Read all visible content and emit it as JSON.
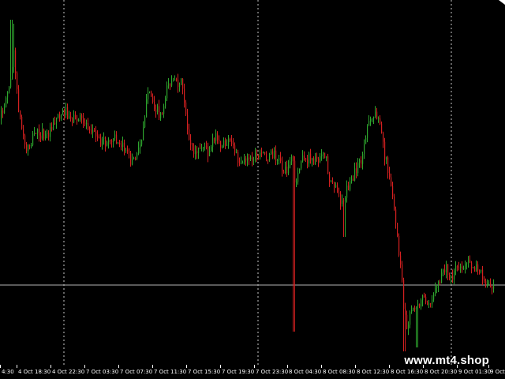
{
  "chart_data": {
    "type": "candlestick",
    "colors": {
      "background": "#000000",
      "bull": "#2ea62e",
      "bear": "#d42020",
      "grid": "#c8c8c8",
      "price_line": "#b4b4b4",
      "text": "#ffffff"
    },
    "grid": "vertical dotted at day separators",
    "x_ticks": [
      "4:30",
      "4 Oct 18:30",
      "4 Oct 22:30",
      "7 Oct 03:30",
      "7 Oct 07:30",
      "7 Oct 11:30",
      "7 Oct 15:30",
      "7 Oct 19:30",
      "7 Oct 23:30",
      "8 Oct 04:30",
      "8 Oct 08:30",
      "8 Oct 12:30",
      "8 Oct 16:30",
      "8 Oct 20:30",
      "9 Oct 01:30",
      "9 Oct 0"
    ],
    "series": [
      {
        "anchors": [
          [
            0,
            150
          ],
          [
            8,
            120
          ],
          [
            14,
            100
          ],
          [
            17,
            60
          ],
          [
            20,
            110
          ],
          [
            25,
            150
          ],
          [
            32,
            190
          ],
          [
            38,
            180
          ],
          [
            45,
            165
          ],
          [
            52,
            170
          ],
          [
            58,
            175
          ],
          [
            66,
            155
          ],
          [
            74,
            145
          ],
          [
            82,
            140
          ],
          [
            90,
            150
          ],
          [
            98,
            150
          ],
          [
            106,
            155
          ],
          [
            114,
            160
          ],
          [
            122,
            175
          ],
          [
            130,
            180
          ],
          [
            138,
            180
          ],
          [
            146,
            175
          ],
          [
            154,
            180
          ],
          [
            160,
            195
          ],
          [
            166,
            205
          ],
          [
            172,
            200
          ],
          [
            178,
            180
          ],
          [
            182,
            150
          ],
          [
            186,
            125
          ],
          [
            190,
            120
          ],
          [
            196,
            135
          ],
          [
            202,
            145
          ],
          [
            206,
            140
          ],
          [
            210,
            110
          ],
          [
            216,
            105
          ],
          [
            222,
            108
          ],
          [
            228,
            100
          ],
          [
            232,
            115
          ],
          [
            236,
            155
          ],
          [
            240,
            180
          ],
          [
            246,
            195
          ],
          [
            252,
            190
          ],
          [
            258,
            185
          ],
          [
            264,
            195
          ],
          [
            270,
            170
          ],
          [
            276,
            180
          ],
          [
            282,
            185
          ],
          [
            288,
            180
          ],
          [
            294,
            185
          ],
          [
            298,
            195
          ],
          [
            304,
            205
          ],
          [
            310,
            200
          ],
          [
            316,
            205
          ],
          [
            322,
            200
          ],
          [
            328,
            200
          ],
          [
            334,
            195
          ],
          [
            340,
            198
          ],
          [
            346,
            195
          ],
          [
            352,
            200
          ],
          [
            356,
            210
          ],
          [
            360,
            220
          ],
          [
            366,
            205
          ],
          [
            370,
            195
          ],
          [
            374,
            240
          ],
          [
            378,
            215
          ],
          [
            382,
            200
          ],
          [
            386,
            205
          ],
          [
            390,
            200
          ],
          [
            396,
            205
          ],
          [
            402,
            200
          ],
          [
            408,
            190
          ],
          [
            412,
            195
          ],
          [
            416,
            225
          ],
          [
            422,
            230
          ],
          [
            428,
            250
          ],
          [
            434,
            255
          ],
          [
            438,
            240
          ],
          [
            442,
            235
          ],
          [
            446,
            230
          ],
          [
            450,
            215
          ],
          [
            454,
            210
          ],
          [
            458,
            200
          ],
          [
            462,
            180
          ],
          [
            466,
            160
          ],
          [
            470,
            150
          ],
          [
            474,
            145
          ],
          [
            478,
            145
          ],
          [
            482,
            170
          ],
          [
            486,
            190
          ],
          [
            490,
            210
          ],
          [
            494,
            225
          ],
          [
            498,
            265
          ],
          [
            502,
            290
          ],
          [
            506,
            330
          ],
          [
            509,
            360
          ],
          [
            512,
            400
          ],
          [
            516,
            420
          ],
          [
            520,
            395
          ],
          [
            524,
            390
          ],
          [
            528,
            380
          ],
          [
            532,
            385
          ],
          [
            536,
            375
          ],
          [
            540,
            380
          ],
          [
            544,
            380
          ],
          [
            548,
            375
          ],
          [
            552,
            370
          ],
          [
            556,
            360
          ],
          [
            560,
            345
          ],
          [
            564,
            340
          ],
          [
            568,
            345
          ],
          [
            572,
            350
          ],
          [
            576,
            340
          ],
          [
            580,
            335
          ],
          [
            584,
            338
          ],
          [
            588,
            340
          ],
          [
            592,
            335
          ],
          [
            596,
            332
          ],
          [
            600,
            338
          ],
          [
            604,
            340
          ],
          [
            608,
            345
          ],
          [
            612,
            352
          ],
          [
            616,
            358
          ],
          [
            620,
            362
          ],
          [
            624,
            358
          ],
          [
            626,
            360
          ]
        ],
        "spikes": [
          [
            14,
            25,
            "high"
          ],
          [
            17,
            30,
            "high"
          ],
          [
            372,
            420,
            "low"
          ],
          [
            436,
            300,
            "low"
          ],
          [
            512,
            445,
            "low"
          ],
          [
            528,
            440,
            "low"
          ]
        ]
      }
    ],
    "last_price_level": 361
  },
  "watermark": "www.mt4.shop"
}
